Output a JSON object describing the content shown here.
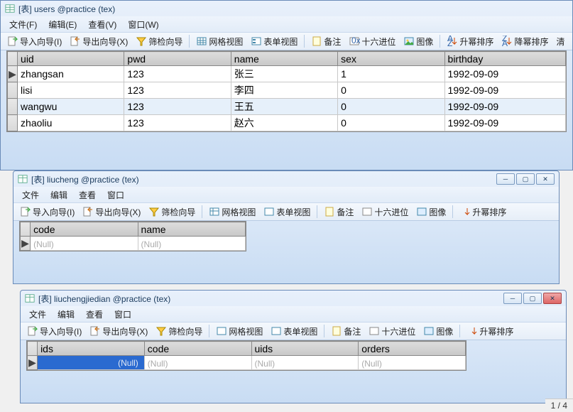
{
  "windows": {
    "users": {
      "title": "[表] users @practice (tex)",
      "menu": {
        "file": "文件(F)",
        "edit": "编辑(E)",
        "view": "查看(V)",
        "window": "窗口(W)"
      }
    },
    "liucheng": {
      "title": "[表] liucheng @practice (tex)",
      "menu": {
        "file": "文件",
        "edit": "编辑",
        "view": "查看",
        "window": "窗口"
      }
    },
    "liuchengjiedian": {
      "title": "[表] liuchengjiedian @practice (tex)",
      "menu": {
        "file": "文件",
        "edit": "编辑",
        "view": "查看",
        "window": "窗口"
      }
    }
  },
  "toolbar": {
    "import": "导入向导(I)",
    "export": "导出向导(X)",
    "filter": "筛检向导",
    "gridview": "网格视图",
    "formview": "表单视图",
    "memo": "备注",
    "hex": "十六进位",
    "image": "图像",
    "asc": "升幂排序",
    "desc": "降幂排序",
    "clr": "清"
  },
  "tables": {
    "users": {
      "columns": [
        "uid",
        "pwd",
        "name",
        "sex",
        "birthday"
      ],
      "rows": [
        {
          "uid": "zhangsan",
          "pwd": "123",
          "name": "张三",
          "sex": "1",
          "birthday": "1992-09-09"
        },
        {
          "uid": "lisi",
          "pwd": "123",
          "name": "李四",
          "sex": "0",
          "birthday": "1992-09-09"
        },
        {
          "uid": "wangwu",
          "pwd": "123",
          "name": "王五",
          "sex": "0",
          "birthday": "1992-09-09"
        },
        {
          "uid": "zhaoliu",
          "pwd": "123",
          "name": "赵六",
          "sex": "0",
          "birthday": "1992-09-09"
        }
      ],
      "selectedRow": 2,
      "cursorRow": 0
    },
    "liucheng": {
      "columns": [
        "code",
        "name"
      ],
      "rows": [
        {
          "code": "(Null)",
          "name": "(Null)"
        }
      ]
    },
    "liuchengjiedian": {
      "columns": [
        "ids",
        "code",
        "uids",
        "orders"
      ],
      "rows": [
        {
          "ids": "(Null)",
          "code": "(Null)",
          "uids": "(Null)",
          "orders": "(Null)"
        }
      ],
      "activeCol": 0
    }
  },
  "status": {
    "page": "1 / 4"
  }
}
